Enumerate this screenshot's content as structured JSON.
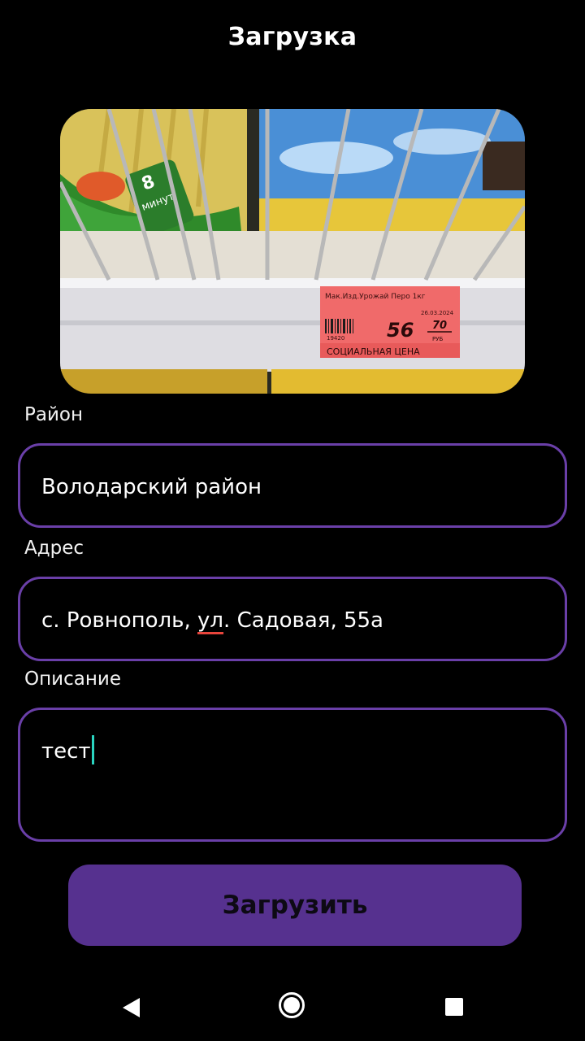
{
  "header": {
    "title": "Загрузка"
  },
  "photo": {
    "subject": "shelf-price-tag",
    "tag_product": "Мак.Изд.Урожай Перо 1кг",
    "tag_date": "26.03.2024",
    "tag_code": "19420",
    "tag_price_rub": "56",
    "tag_price_kop": "70",
    "tag_currency": "РУБ",
    "tag_banner": "СОЦИАЛЬНАЯ ЦЕНА",
    "pack_badge_number": "8",
    "pack_badge_text": "минут"
  },
  "form": {
    "district": {
      "label": "Район",
      "value": "Володарский район"
    },
    "address": {
      "label": "Адрес",
      "value_before": "с. Ровнополь, ",
      "value_underlined": "ул",
      "value_after": ". Садовая, 55а"
    },
    "description": {
      "label": "Описание",
      "value": "тест"
    }
  },
  "submit_label": "Загрузить",
  "colors": {
    "accent": "#56318f",
    "border": "#6a3fa8",
    "caret": "#2ad4c0"
  },
  "navbar": {
    "back_icon": "triangle-back-icon",
    "home_icon": "circle-home-icon",
    "recent_icon": "square-recents-icon"
  }
}
